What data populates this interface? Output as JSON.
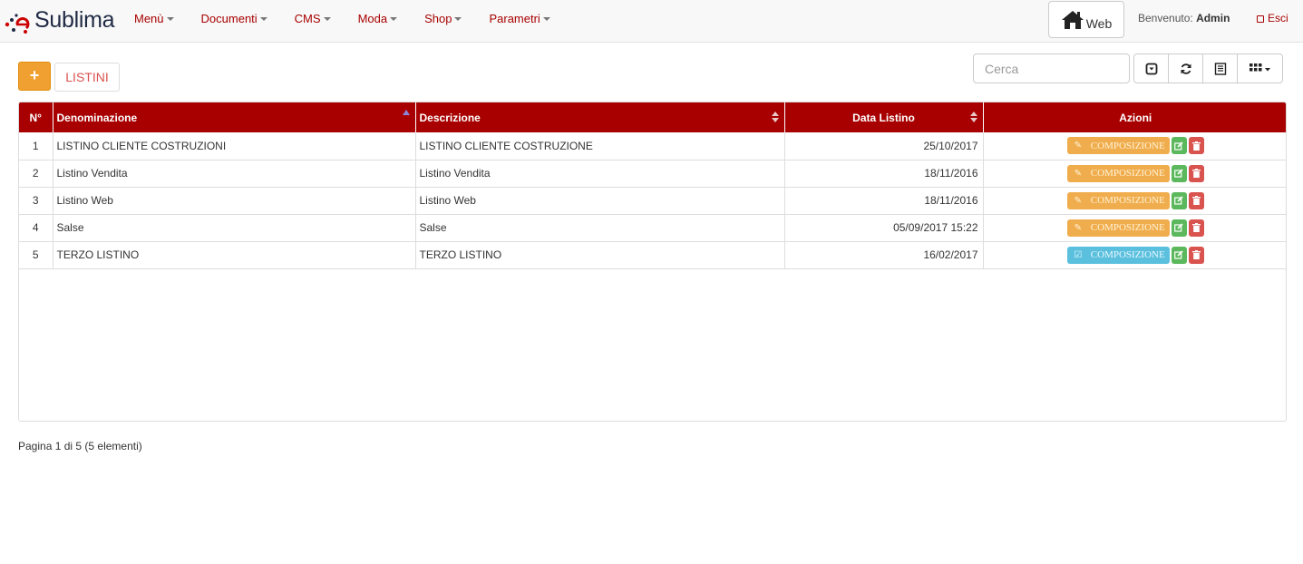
{
  "app": {
    "brand": "Sublima"
  },
  "nav": {
    "items": [
      "Menù",
      "Documenti",
      "CMS",
      "Moda",
      "Shop",
      "Parametri"
    ],
    "web_label": "Web",
    "welcome_prefix": "Benvenuto:",
    "welcome_user": "Admin",
    "logout": "Esci"
  },
  "toolbar": {
    "add_label": "+",
    "title": "LISTINI",
    "search_placeholder": "Cerca"
  },
  "table": {
    "columns": [
      "N°",
      "Denominazione",
      "Descrizione",
      "Data Listino",
      "Azioni"
    ],
    "rows": [
      {
        "n": "1",
        "denominazione": "LISTINO CLIENTE COSTRUZIONI",
        "descrizione": "LISTINO CLIENTE COSTRUZIONE",
        "data": "25/10/2017",
        "action": "COMPOSIZIONE",
        "style": "warning"
      },
      {
        "n": "2",
        "denominazione": "Listino Vendita",
        "descrizione": "Listino Vendita",
        "data": "18/11/2016",
        "action": "COMPOSIZIONE",
        "style": "warning"
      },
      {
        "n": "3",
        "denominazione": "Listino Web",
        "descrizione": "Listino Web",
        "data": "18/11/2016",
        "action": "COMPOSIZIONE",
        "style": "warning"
      },
      {
        "n": "4",
        "denominazione": "Salse",
        "descrizione": "Salse",
        "data": "05/09/2017 15:22",
        "action": "COMPOSIZIONE",
        "style": "warning"
      },
      {
        "n": "5",
        "denominazione": "TERZO LISTINO",
        "descrizione": "TERZO LISTINO",
        "data": "16/02/2017",
        "action": "COMPOSIZIONE",
        "style": "info"
      }
    ]
  },
  "pagination": {
    "info": "Pagina 1 di 5 (5 elementi)"
  },
  "colors": {
    "primary": "#a80000",
    "warning": "#f0ad4e",
    "info": "#5bc0de",
    "success": "#5cb85c",
    "danger": "#d9534f"
  }
}
